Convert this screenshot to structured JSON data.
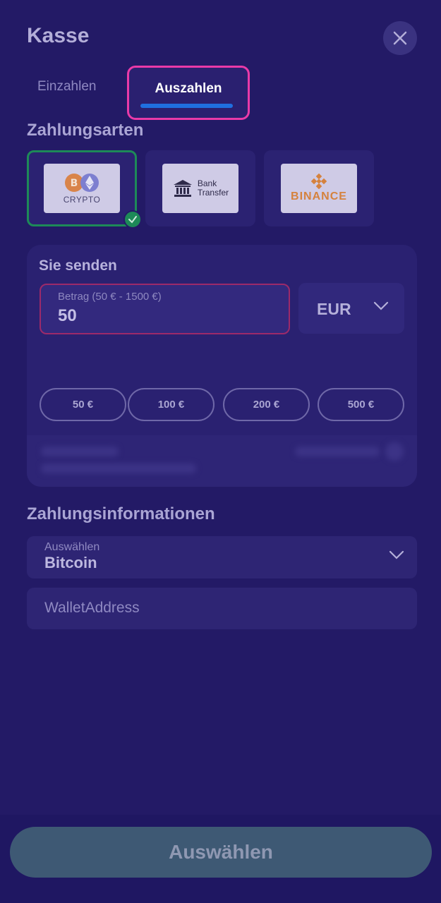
{
  "header": {
    "title": "Kasse",
    "close_icon": "close-icon"
  },
  "tabs": [
    {
      "label": "Einzahlen",
      "active": false
    },
    {
      "label": "Auszahlen",
      "active": true
    }
  ],
  "payment_methods": {
    "title": "Zahlungsarten",
    "items": [
      {
        "name": "crypto",
        "label": "CRYPTO",
        "selected": true
      },
      {
        "name": "bank-transfer",
        "label_line1": "Bank",
        "label_line2": "Transfer",
        "selected": false
      },
      {
        "name": "binance",
        "label": "BINANCE",
        "selected": false
      }
    ]
  },
  "send": {
    "title": "Sie senden",
    "amount_label": "Betrag (50 € - 1500 €)",
    "amount_value": "50",
    "currency": "EUR",
    "quick_amounts": [
      "50 €",
      "100 €",
      "200 €",
      "500 €"
    ]
  },
  "payment_info": {
    "title": "Zahlungsinformationen",
    "select_label": "Auswählen",
    "select_value": "Bitcoin",
    "wallet_placeholder": "WalletAddress"
  },
  "footer": {
    "submit_label": "Auswählen"
  },
  "colors": {
    "background": "#231a66",
    "tab_highlight": "#e93aa8",
    "tab_underline": "#1f6fe0",
    "selected_border": "#1d8a58",
    "amount_error_border": "#9c2a6a",
    "submit_button": "#3e5974"
  }
}
